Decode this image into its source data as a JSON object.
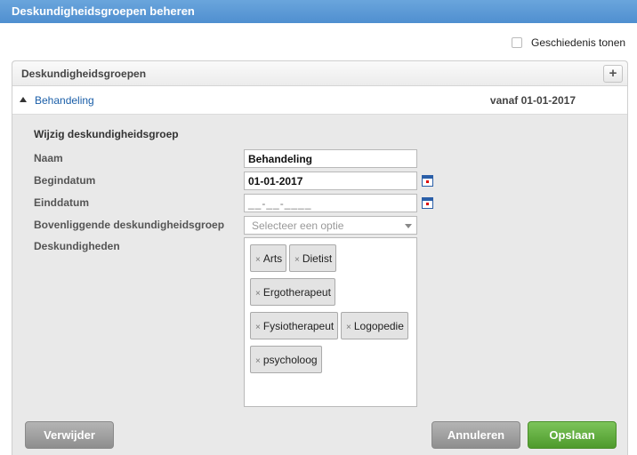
{
  "window": {
    "title": "Deskundigheidsgroepen beheren"
  },
  "history_toggle": {
    "label": "Geschiedenis tonen",
    "checked": false
  },
  "panel": {
    "title": "Deskundigheidsgroepen",
    "add_label": "+",
    "group": {
      "name": "Behandeling",
      "date": "vanaf 01-01-2017"
    }
  },
  "form": {
    "title": "Wijzig deskundigheidsgroep",
    "name_label": "Naam",
    "name_value": "Behandeling",
    "start_label": "Begindatum",
    "start_value": "01-01-2017",
    "end_label": "Einddatum",
    "end_value": "__-__-____",
    "parent_label": "Bovenliggende deskundigheidsgroep",
    "parent_placeholder": "Selecteer een optie",
    "skills_label": "Deskundigheden",
    "skills": [
      "Arts",
      "Dietist",
      "Ergotherapeut",
      "Fysiotherapeut",
      "Logopedie",
      "psycholoog"
    ]
  },
  "buttons": {
    "delete": "Verwijder",
    "cancel": "Annuleren",
    "save": "Opslaan"
  },
  "colors": {
    "title_bar": "#5b9bd8",
    "link": "#1a5ea8",
    "save": "#5aa838",
    "grey_button": "#9e9e9e"
  }
}
